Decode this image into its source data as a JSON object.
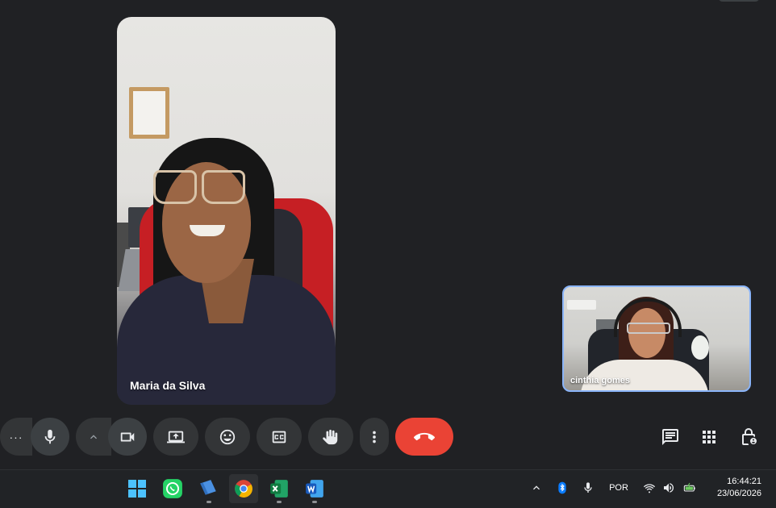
{
  "call": {
    "main_participant": {
      "name": "Maria da Silva"
    },
    "self_view": {
      "name": "cinthia gomes"
    }
  },
  "controls": {
    "more_options_left": "···",
    "accent_end_call": "#ea4335",
    "self_view_border": "#8ab4f8"
  },
  "taskbar": {
    "apps": [
      {
        "name": "Start",
        "icon": "windows-start-icon"
      },
      {
        "name": "WhatsApp",
        "icon": "whatsapp-icon"
      },
      {
        "name": "Files",
        "icon": "files-icon"
      },
      {
        "name": "Chrome",
        "icon": "chrome-icon"
      },
      {
        "name": "Excel",
        "icon": "excel-icon"
      },
      {
        "name": "Word",
        "icon": "word-icon"
      }
    ],
    "input_language": "POR",
    "time": "16:44:21",
    "date": "23/06/2026"
  }
}
